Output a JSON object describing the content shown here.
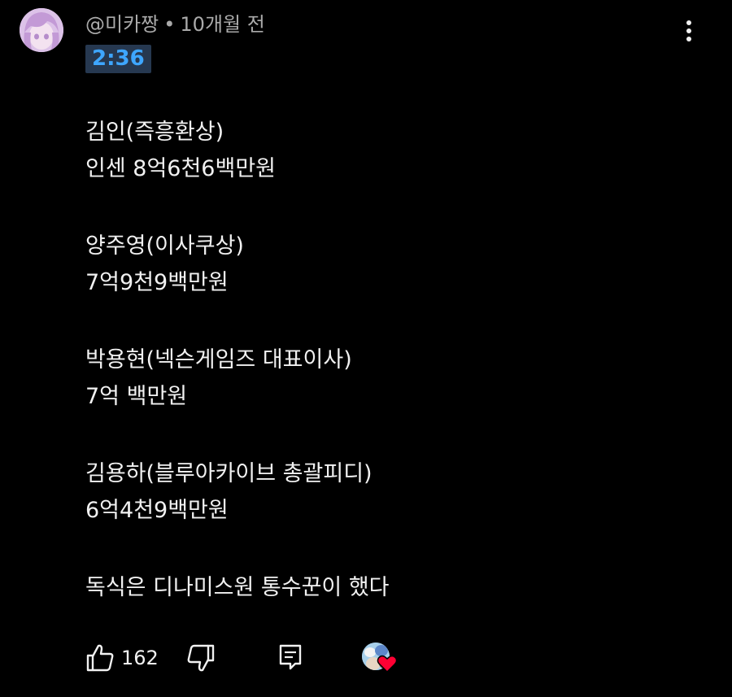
{
  "comment": {
    "author": "@미카짱",
    "separator": "•",
    "posted": "10개월 전",
    "timestamp_link": "2:36",
    "lines": [
      "김인(즉흥환상)",
      "인센 8억6천6백만원",
      "양주영(이사쿠상)",
      "7억9천9백만원",
      "박용현(넥슨게임즈 대표이사)",
      "7억 백만원",
      "김용하(블루아카이브 총괄피디)",
      "6억4천9백만원",
      "독식은 디나미스원 통수꾼이 했다"
    ],
    "like_count": "162"
  },
  "icons": {
    "more": "more-vert-icon",
    "like": "thumbs-up-icon",
    "dislike": "thumbs-down-icon",
    "reply": "reply-comment-icon",
    "heart": "heart-icon"
  },
  "colors": {
    "background": "#000000",
    "text": "#f1f1f1",
    "secondary_text": "#aaaaaa",
    "timestamp_link": "#3ea6ff",
    "timestamp_bg": "#263850",
    "heart": "#ff0033"
  }
}
